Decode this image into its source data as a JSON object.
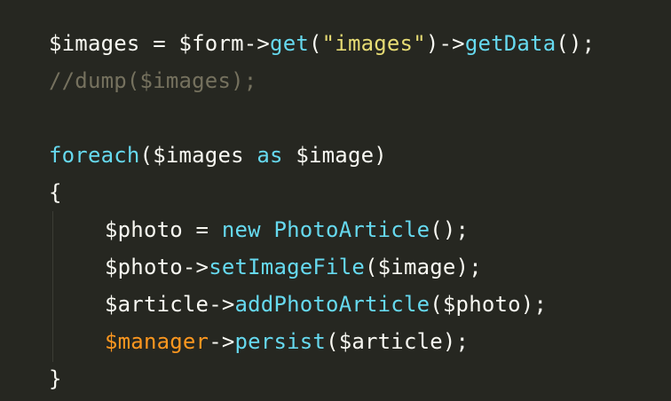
{
  "code": {
    "lines": [
      [
        {
          "text": "$images = $form->",
          "type": "default"
        },
        {
          "text": "get",
          "type": "func"
        },
        {
          "text": "(",
          "type": "default"
        },
        {
          "text": "\"images\"",
          "type": "string"
        },
        {
          "text": ")->",
          "type": "default"
        },
        {
          "text": "getData",
          "type": "func"
        },
        {
          "text": "();",
          "type": "default"
        }
      ],
      [
        {
          "text": "//dump($images);",
          "type": "comment"
        }
      ],
      [],
      [
        {
          "text": "foreach",
          "type": "keyword"
        },
        {
          "text": "($images ",
          "type": "default"
        },
        {
          "text": "as",
          "type": "keyword"
        },
        {
          "text": " $image)",
          "type": "default"
        }
      ],
      [
        {
          "text": "{",
          "type": "default"
        }
      ],
      [
        {
          "text": "$photo = ",
          "type": "default"
        },
        {
          "text": "new",
          "type": "keyword"
        },
        {
          "text": " ",
          "type": "default"
        },
        {
          "text": "PhotoArticle",
          "type": "class"
        },
        {
          "text": "();",
          "type": "default"
        }
      ],
      [
        {
          "text": "$photo->",
          "type": "default"
        },
        {
          "text": "setImageFile",
          "type": "func"
        },
        {
          "text": "($image);",
          "type": "default"
        }
      ],
      [
        {
          "text": "$article->",
          "type": "default"
        },
        {
          "text": "addPhotoArticle",
          "type": "func"
        },
        {
          "text": "($photo);",
          "type": "default"
        }
      ],
      [
        {
          "text": "$manager",
          "type": "var-special"
        },
        {
          "text": "->",
          "type": "default"
        },
        {
          "text": "persist",
          "type": "func"
        },
        {
          "text": "($article);",
          "type": "default"
        }
      ],
      [
        {
          "text": "}",
          "type": "default"
        }
      ]
    ]
  },
  "theme": {
    "background": "#272822",
    "default": "#f8f8f2",
    "function": "#66d9ef",
    "string": "#e6db74",
    "comment": "#75715e",
    "special_variable": "#fd971f"
  }
}
